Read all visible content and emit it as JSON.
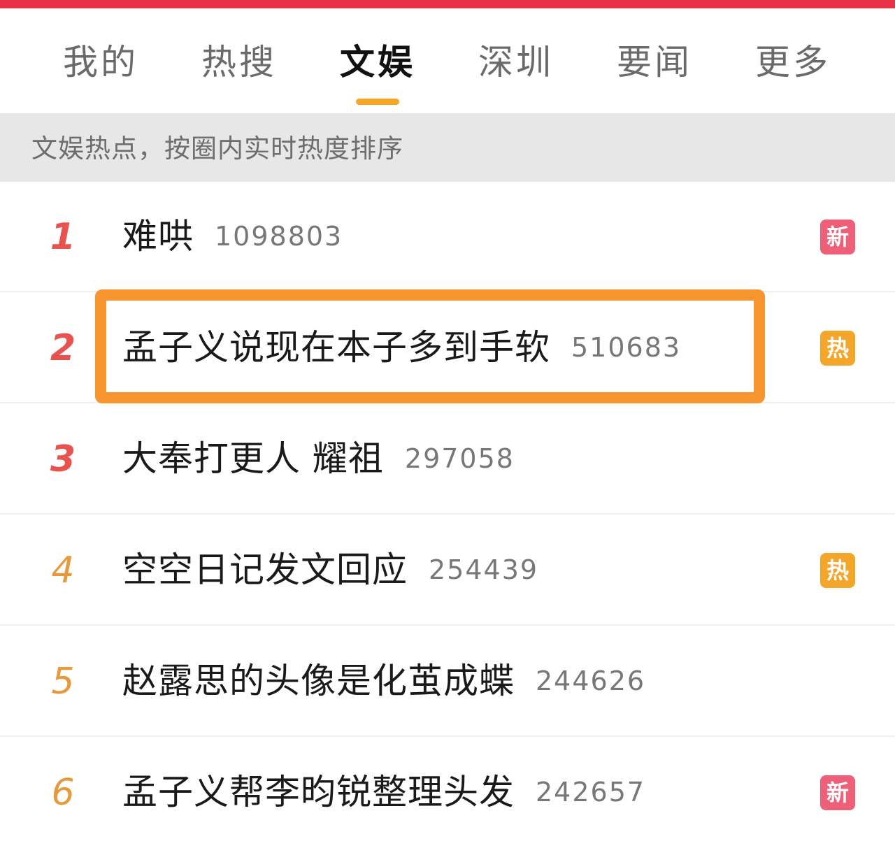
{
  "tabs": [
    {
      "label": "我的"
    },
    {
      "label": "热搜"
    },
    {
      "label": "文娱"
    },
    {
      "label": "深圳"
    },
    {
      "label": "要闻"
    },
    {
      "label": "更多"
    }
  ],
  "active_tab": "文娱",
  "hint": "文娱热点，按圈内实时热度排序",
  "items": [
    {
      "rank": "1",
      "title": "难哄",
      "heat": "1098803",
      "badge": "新",
      "badge_color": "#ee5f78"
    },
    {
      "rank": "2",
      "title": "孟子义说现在本子多到手软",
      "heat": "510683",
      "badge": "热",
      "badge_color": "#f3a629"
    },
    {
      "rank": "3",
      "title": "大奉打更人 耀祖",
      "heat": "297058",
      "badge": "",
      "badge_color": ""
    },
    {
      "rank": "4",
      "title": "空空日记发文回应",
      "heat": "254439",
      "badge": "热",
      "badge_color": "#f3a629"
    },
    {
      "rank": "5",
      "title": "赵露思的头像是化茧成蝶",
      "heat": "244626",
      "badge": "",
      "badge_color": ""
    },
    {
      "rank": "6",
      "title": "孟子义帮李昀锐整理头发",
      "heat": "242657",
      "badge": "新",
      "badge_color": "#ee5f78"
    }
  ],
  "colors": {
    "brand_red": "#e8334b",
    "tab_indicator": "#f6a623",
    "highlight_box": "#f7952f",
    "rank_top": "#e9534f",
    "rank_mid": "#e79a3b"
  }
}
